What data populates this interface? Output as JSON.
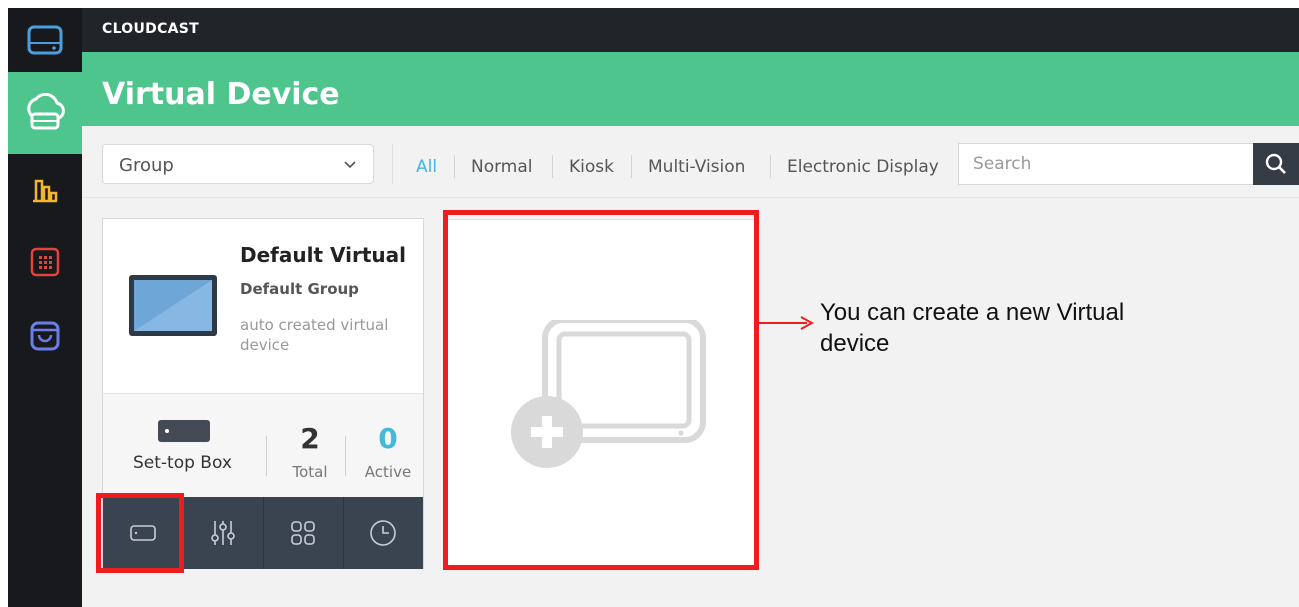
{
  "app": {
    "brand": "CLOUDCAST"
  },
  "page": {
    "title": "Virtual Device"
  },
  "sidebar": {
    "items": [
      {
        "icon": "storage-icon",
        "active": false
      },
      {
        "icon": "cloud-device-icon",
        "active": true
      },
      {
        "icon": "chart-icon",
        "active": false
      },
      {
        "icon": "grid-calendar-icon",
        "active": false
      },
      {
        "icon": "bag-icon",
        "active": false
      }
    ]
  },
  "filter": {
    "group_select": {
      "value": "Group"
    },
    "tabs": [
      {
        "label": "All",
        "active": true
      },
      {
        "label": "Normal",
        "active": false
      },
      {
        "label": "Kiosk",
        "active": false
      },
      {
        "label": "Multi-Vision",
        "active": false
      },
      {
        "label": "Electronic Display",
        "active": false
      }
    ],
    "search": {
      "placeholder": "Search",
      "value": ""
    }
  },
  "device_card": {
    "name": "Default Virtual",
    "group": "Default Group",
    "description": "auto created virtual device",
    "type_label": "Set-top Box",
    "total": "2",
    "total_label": "Total",
    "active": "0",
    "active_label": "Active",
    "actions": [
      "set-top-box-icon",
      "equalizer-icon",
      "apps-grid-icon",
      "clock-icon"
    ]
  },
  "add_card": {
    "icon": "add-device-icon"
  },
  "annotation": {
    "text": "You can create a new Virtual device",
    "color": "#ee1c1c"
  },
  "colors": {
    "accent": "#4fc58e",
    "active_tab": "#40b6e6",
    "sidebar": "#17191c",
    "action_bar": "#3a4350"
  }
}
